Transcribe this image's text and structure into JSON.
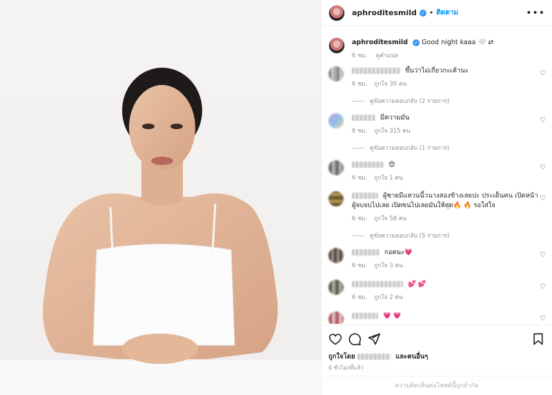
{
  "post": {
    "username": "aphroditesmild",
    "follow_label": "ติดตาม",
    "dot": "•",
    "more_label": "•••",
    "caption_text": "Good night kaaa 🤍 ⇄",
    "caption_time": "6 ชม.",
    "caption_translate": "ดูคำแปล"
  },
  "comments": [
    {
      "text": "ขึ้นว่าไม่เกี่ยวกะเค้านะ",
      "time": "6 ชม.",
      "likes": "ถูกใจ 30 คน",
      "replies": "ดูข้อความตอบกลับ (2 รายการ)"
    },
    {
      "text": "มีความมัน",
      "time": "6 ชม.",
      "likes": "ถูกใจ 315 คน",
      "replies": "ดูข้อความตอบกลับ (1 รายการ)"
    },
    {
      "text": "😍",
      "time": "6 ชม.",
      "likes": "ถูกใจ 1 คน",
      "replies": ""
    },
    {
      "text": "ผู้ชายมีแหวนนี้วนางสองข้างเลยปะ ประเด็นคน เปิดหน้าผู้จบจบไปเลย เปิดขนไปเลยมันให้สุด🔥 🔥 รอใส่ใจ",
      "time": "6 ชม.",
      "likes": "ถูกใจ 58 คน",
      "replies": "ดูข้อความตอบกลับ (5 รายการ)"
    },
    {
      "text": "กอดนะ💗",
      "time": "6 ชม.",
      "likes": "ถูกใจ 3 คน",
      "replies": ""
    },
    {
      "text": "💕 💕",
      "time": "6 ชม.",
      "likes": "ถูกใจ 2 คน",
      "replies": ""
    },
    {
      "text": "💗 💗",
      "time": "",
      "likes": "",
      "replies": ""
    }
  ],
  "footer": {
    "liked_by_prefix": "ถูกใจโดย",
    "liked_by_suffix": "และคนอื่นๆ",
    "posted_ago": "6 ชั่วโมงที่แล้ว",
    "comments_disabled": "ความคิดเห็นต่อโพสต์นี้ถูกจำกัด"
  },
  "icons": [
    "heart-icon",
    "comment-icon",
    "share-icon",
    "bookmark-icon",
    "verified-icon",
    "more-options-icon"
  ],
  "colors": {
    "accent": "#0095f6",
    "verified": "#3897f0",
    "muted": "#8e8e8e"
  }
}
